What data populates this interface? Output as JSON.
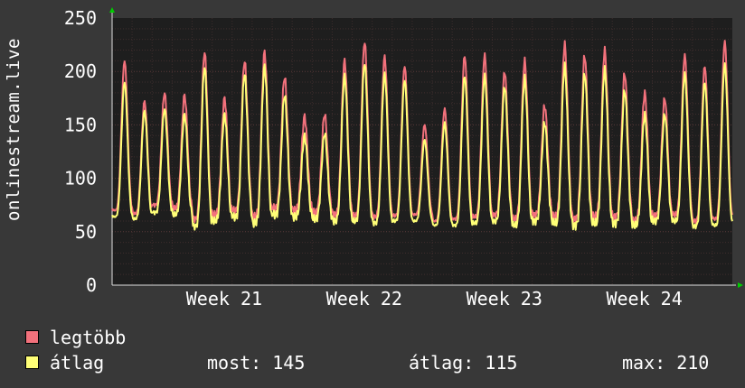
{
  "y_axis_label": "onlinestream.live",
  "colors": {
    "background": "#383838",
    "plot_bg": "#1e1e1e",
    "grid": "#5a3a3a",
    "max_series": "#f2717c",
    "avg_series": "#f5f56a",
    "arrows": "#00cc00"
  },
  "legend": {
    "max": {
      "label": "legtöbb",
      "color": "#f2717c"
    },
    "avg": {
      "label": "átlag",
      "color": "#ffff77"
    }
  },
  "stats": {
    "now": "most: 145",
    "avg": "átlag: 115",
    "max": "max: 210"
  },
  "chart_data": {
    "type": "line",
    "x_unit": "day",
    "x_range_days": [
      0,
      31
    ],
    "ylim": [
      0,
      250
    ],
    "y_ticks": [
      0,
      50,
      100,
      150,
      200,
      250
    ],
    "x_ticks": [
      {
        "label": "Week 21",
        "day": 5.6
      },
      {
        "label": "Week 22",
        "day": 12.6
      },
      {
        "label": "Week 23",
        "day": 19.6
      },
      {
        "label": "Week 24",
        "day": 26.6
      }
    ],
    "grid": true,
    "series": [
      {
        "name": "legtöbb",
        "color": "#f2717c",
        "daily_peak": [
          210,
          172,
          180,
          178,
          218,
          175,
          210,
          218,
          195,
          158,
          160,
          210,
          228,
          214,
          205,
          150,
          165,
          215,
          215,
          200,
          210,
          168,
          225,
          215,
          220,
          198,
          180,
          175,
          215,
          205,
          228,
          160
        ],
        "daily_low": [
          70,
          67,
          75,
          72,
          62,
          66,
          70,
          64,
          72,
          70,
          68,
          66,
          65,
          64,
          65,
          66,
          60,
          62,
          64,
          66,
          62,
          66,
          64,
          62,
          64,
          64,
          60,
          65,
          66,
          60,
          62,
          64
        ]
      },
      {
        "name": "átlag",
        "color": "#ffff77",
        "daily_peak": [
          190,
          163,
          165,
          160,
          204,
          160,
          198,
          205,
          178,
          140,
          142,
          196,
          208,
          198,
          192,
          136,
          152,
          196,
          196,
          186,
          194,
          152,
          205,
          198,
          202,
          182,
          160,
          160,
          198,
          190,
          207,
          145
        ],
        "daily_low": [
          64,
          62,
          68,
          66,
          55,
          60,
          64,
          58,
          66,
          64,
          62,
          60,
          60,
          58,
          60,
          60,
          56,
          56,
          58,
          60,
          56,
          60,
          58,
          56,
          58,
          58,
          56,
          60,
          60,
          55,
          56,
          58
        ]
      }
    ]
  }
}
